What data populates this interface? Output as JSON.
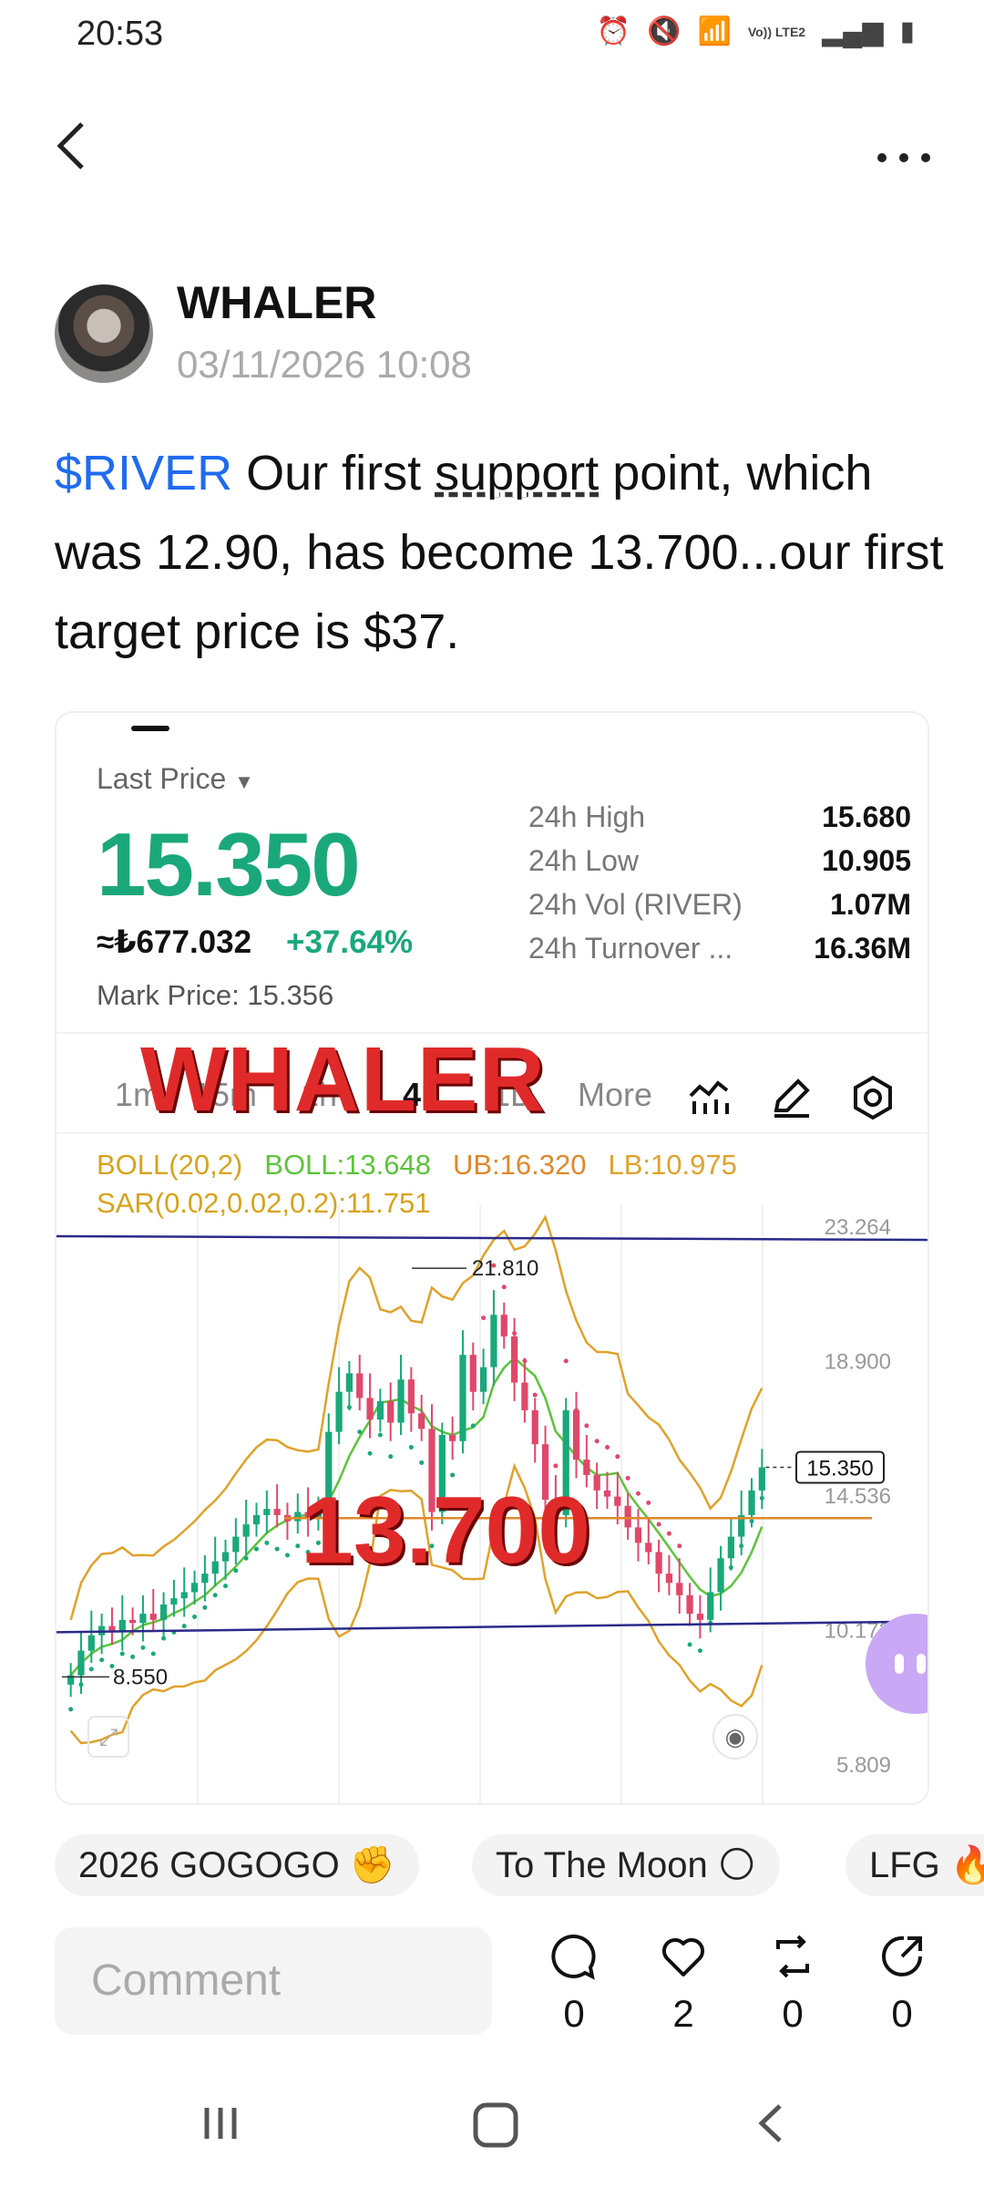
{
  "status_bar": {
    "time": "20:53",
    "network_label": "Vo)) LTE2"
  },
  "post": {
    "author": "WHALER",
    "timestamp": "03/11/2026 10:08",
    "ticker": "$RIVER",
    "text_part1": " Our first ",
    "text_underlined": "support",
    "text_part2": " point, which was 12.90, has become 13.700...our first target price is $37."
  },
  "card": {
    "last_price_label": "Last Price",
    "last_price": "15.350",
    "fiat_price": "≈₺677.032",
    "change": "+37.64%",
    "mark_price_label": "Mark Price:",
    "mark_price": "15.356",
    "stats": [
      {
        "key": "24h  High",
        "value": "15.680"
      },
      {
        "key": "24h  Low",
        "value": "10.905"
      },
      {
        "key": "24h  Vol (RIVER)",
        "value": "1.07M"
      },
      {
        "key": "24h  Turnover ...",
        "value": "16.36M"
      }
    ],
    "timeframes": [
      "1m",
      "15m",
      "1h",
      "4h",
      "1D",
      "More"
    ],
    "active_timeframe": "4h",
    "watermark_top": "WHALER",
    "watermark_mid": "13.700",
    "indicators": {
      "boll": "BOLL(20,2)",
      "boll_mid": "BOLL:13.648",
      "ub": "UB:16.320",
      "lb": "LB:10.975",
      "sar": "SAR(0.02,0.02,0.2):11.751"
    },
    "colors": {
      "up": "#1aa87a",
      "down": "#e0486a",
      "boll_mid": "#5cc43b",
      "boll_band": "#e0a22a",
      "trendline": "#2a2a8a"
    }
  },
  "chart_data": {
    "type": "candlestick",
    "y_ticks": [
      "23.264",
      "18.900",
      "14.536",
      "10.172",
      "5.809"
    ],
    "ylim": [
      5.809,
      23.264
    ],
    "current_price_label": "15.350",
    "high_label": "21.810",
    "low_label": "8.550",
    "high": 21.81,
    "low": 8.55,
    "current": 15.35,
    "support_level": 13.7,
    "closes": [
      8.6,
      9.4,
      9.9,
      10.2,
      10.0,
      10.4,
      10.3,
      10.6,
      10.4,
      10.9,
      11.1,
      11.3,
      11.6,
      11.9,
      12.3,
      12.6,
      13.1,
      13.5,
      13.8,
      14.0,
      13.8,
      13.6,
      13.9,
      13.7,
      14.0,
      16.5,
      17.8,
      18.4,
      17.6,
      16.9,
      17.5,
      16.8,
      18.2,
      17.1,
      16.6,
      13.9,
      16.4,
      16.2,
      19.0,
      17.8,
      18.6,
      20.3,
      19.6,
      18.1,
      17.2,
      16.1,
      14.3,
      13.8,
      17.2,
      15.6,
      15.1,
      14.6,
      14.4,
      14.1,
      13.4,
      12.9,
      12.6,
      11.9,
      11.6,
      11.2,
      10.6,
      10.4,
      11.3,
      12.4,
      13.1,
      13.8,
      14.6,
      15.35
    ]
  },
  "hashtags": [
    "2026 GOGOGO ✊",
    "To The Moon 🌕",
    "LFG 🔥"
  ],
  "comment_placeholder": "Comment",
  "actions": {
    "comments": "0",
    "likes": "2",
    "reposts": "0",
    "shares": "0"
  }
}
